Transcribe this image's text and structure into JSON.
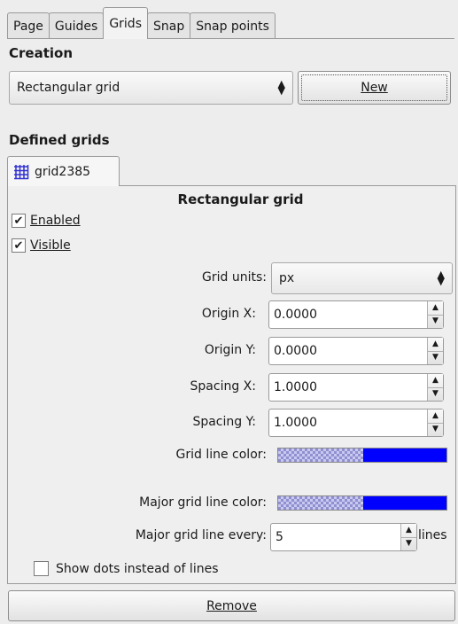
{
  "tabs": [
    {
      "label": "Page"
    },
    {
      "label": "Guides"
    },
    {
      "label": "Grids"
    },
    {
      "label": "Snap"
    },
    {
      "label": "Snap points"
    }
  ],
  "creation": {
    "title": "Creation",
    "grid_type": "Rectangular grid",
    "new_button": "New"
  },
  "defined": {
    "title": "Defined grids",
    "grid_tab": "grid2385"
  },
  "grid": {
    "heading": "Rectangular grid",
    "enabled_label": "Enabled",
    "visible_label": "Visible",
    "enabled": true,
    "visible": true,
    "units_label": "Grid units:",
    "units_value": "px",
    "origin_x_label": "Origin X:",
    "origin_x": "0.0000",
    "origin_y_label": "Origin Y:",
    "origin_y": "0.0000",
    "spacing_x_label": "Spacing X:",
    "spacing_x": "1.0000",
    "spacing_y_label": "Spacing Y:",
    "spacing_y": "1.0000",
    "line_color_label": "Grid line color:",
    "major_color_label": "Major grid line color:",
    "line_color": "#0000ff",
    "major_color": "#0000ff",
    "major_every_label": "Major grid line every:",
    "major_every": "5",
    "lines_suffix": "lines",
    "dots_label": "Show dots instead of lines",
    "dots": false
  },
  "remove_button": "Remove"
}
